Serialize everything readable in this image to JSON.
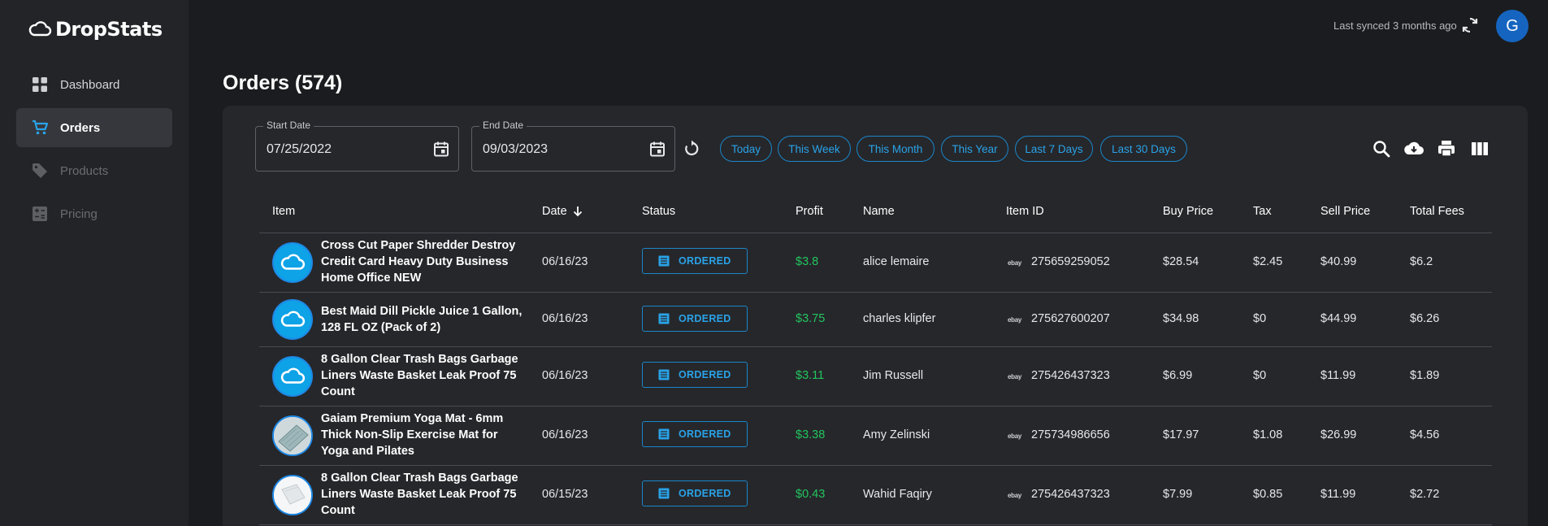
{
  "app": {
    "name": "DropStats"
  },
  "sidebar": {
    "items": [
      {
        "label": "Dashboard",
        "icon": "dashboard-icon",
        "state": "enabled"
      },
      {
        "label": "Orders",
        "icon": "cart-icon",
        "state": "active"
      },
      {
        "label": "Products",
        "icon": "tag-icon",
        "state": "disabled"
      },
      {
        "label": "Pricing",
        "icon": "calculator-icon",
        "state": "disabled"
      }
    ]
  },
  "header": {
    "sync_text": "Last synced 3 months ago",
    "avatar_initial": "G"
  },
  "page": {
    "title": "Orders (574)"
  },
  "filters": {
    "start_label": "Start Date",
    "start_value": "07/25/2022",
    "end_label": "End Date",
    "end_value": "09/03/2023",
    "chips": [
      "Today",
      "This Week",
      "This Month",
      "This Year",
      "Last 7 Days",
      "Last 30 Days"
    ]
  },
  "table": {
    "columns": [
      "Item",
      "Date",
      "Status",
      "Profit",
      "Name",
      "Item ID",
      "Buy Price",
      "Tax",
      "Sell Price",
      "Total Fees"
    ],
    "sort_column": "Date",
    "rows": [
      {
        "item": "Cross Cut Paper Shredder Destroy Credit Card Heavy Duty Business Home Office NEW",
        "date": "06/16/23",
        "status": "ORDERED",
        "profit": "$3.8",
        "name": "alice lemaire",
        "platform": "ebay",
        "item_id": "275659259052",
        "buy": "$28.54",
        "tax": "$2.45",
        "sell": "$40.99",
        "fees": "$6.2",
        "thumb": "cloud"
      },
      {
        "item": "Best Maid Dill Pickle Juice 1 Gallon, 128 FL OZ (Pack of 2)",
        "date": "06/16/23",
        "status": "ORDERED",
        "profit": "$3.75",
        "name": "charles klipfer",
        "platform": "ebay",
        "item_id": "275627600207",
        "buy": "$34.98",
        "tax": "$0",
        "sell": "$44.99",
        "fees": "$6.26",
        "thumb": "cloud"
      },
      {
        "item": "8 Gallon Clear Trash Bags Garbage Liners Waste Basket Leak Proof 75 Count",
        "date": "06/16/23",
        "status": "ORDERED",
        "profit": "$3.11",
        "name": "Jim Russell",
        "platform": "ebay",
        "item_id": "275426437323",
        "buy": "$6.99",
        "tax": "$0",
        "sell": "$11.99",
        "fees": "$1.89",
        "thumb": "cloud"
      },
      {
        "item": "Gaiam Premium Yoga Mat - 6mm Thick Non-Slip Exercise Mat for Yoga and Pilates",
        "date": "06/16/23",
        "status": "ORDERED",
        "profit": "$3.38",
        "name": "Amy Zelinski",
        "platform": "ebay",
        "item_id": "275734986656",
        "buy": "$17.97",
        "tax": "$1.08",
        "sell": "$26.99",
        "fees": "$4.56",
        "thumb": "mat"
      },
      {
        "item": "8 Gallon Clear Trash Bags Garbage Liners Waste Basket Leak Proof 75 Count",
        "date": "06/15/23",
        "status": "ORDERED",
        "profit": "$0.43",
        "name": "Wahid Faqiry",
        "platform": "ebay",
        "item_id": "275426437323",
        "buy": "$7.99",
        "tax": "$0.85",
        "sell": "$11.99",
        "fees": "$2.72",
        "thumb": "bag"
      }
    ]
  },
  "colors": {
    "accent": "#29a3e8",
    "profit": "#22c55e",
    "avatar": "#1565c0"
  }
}
